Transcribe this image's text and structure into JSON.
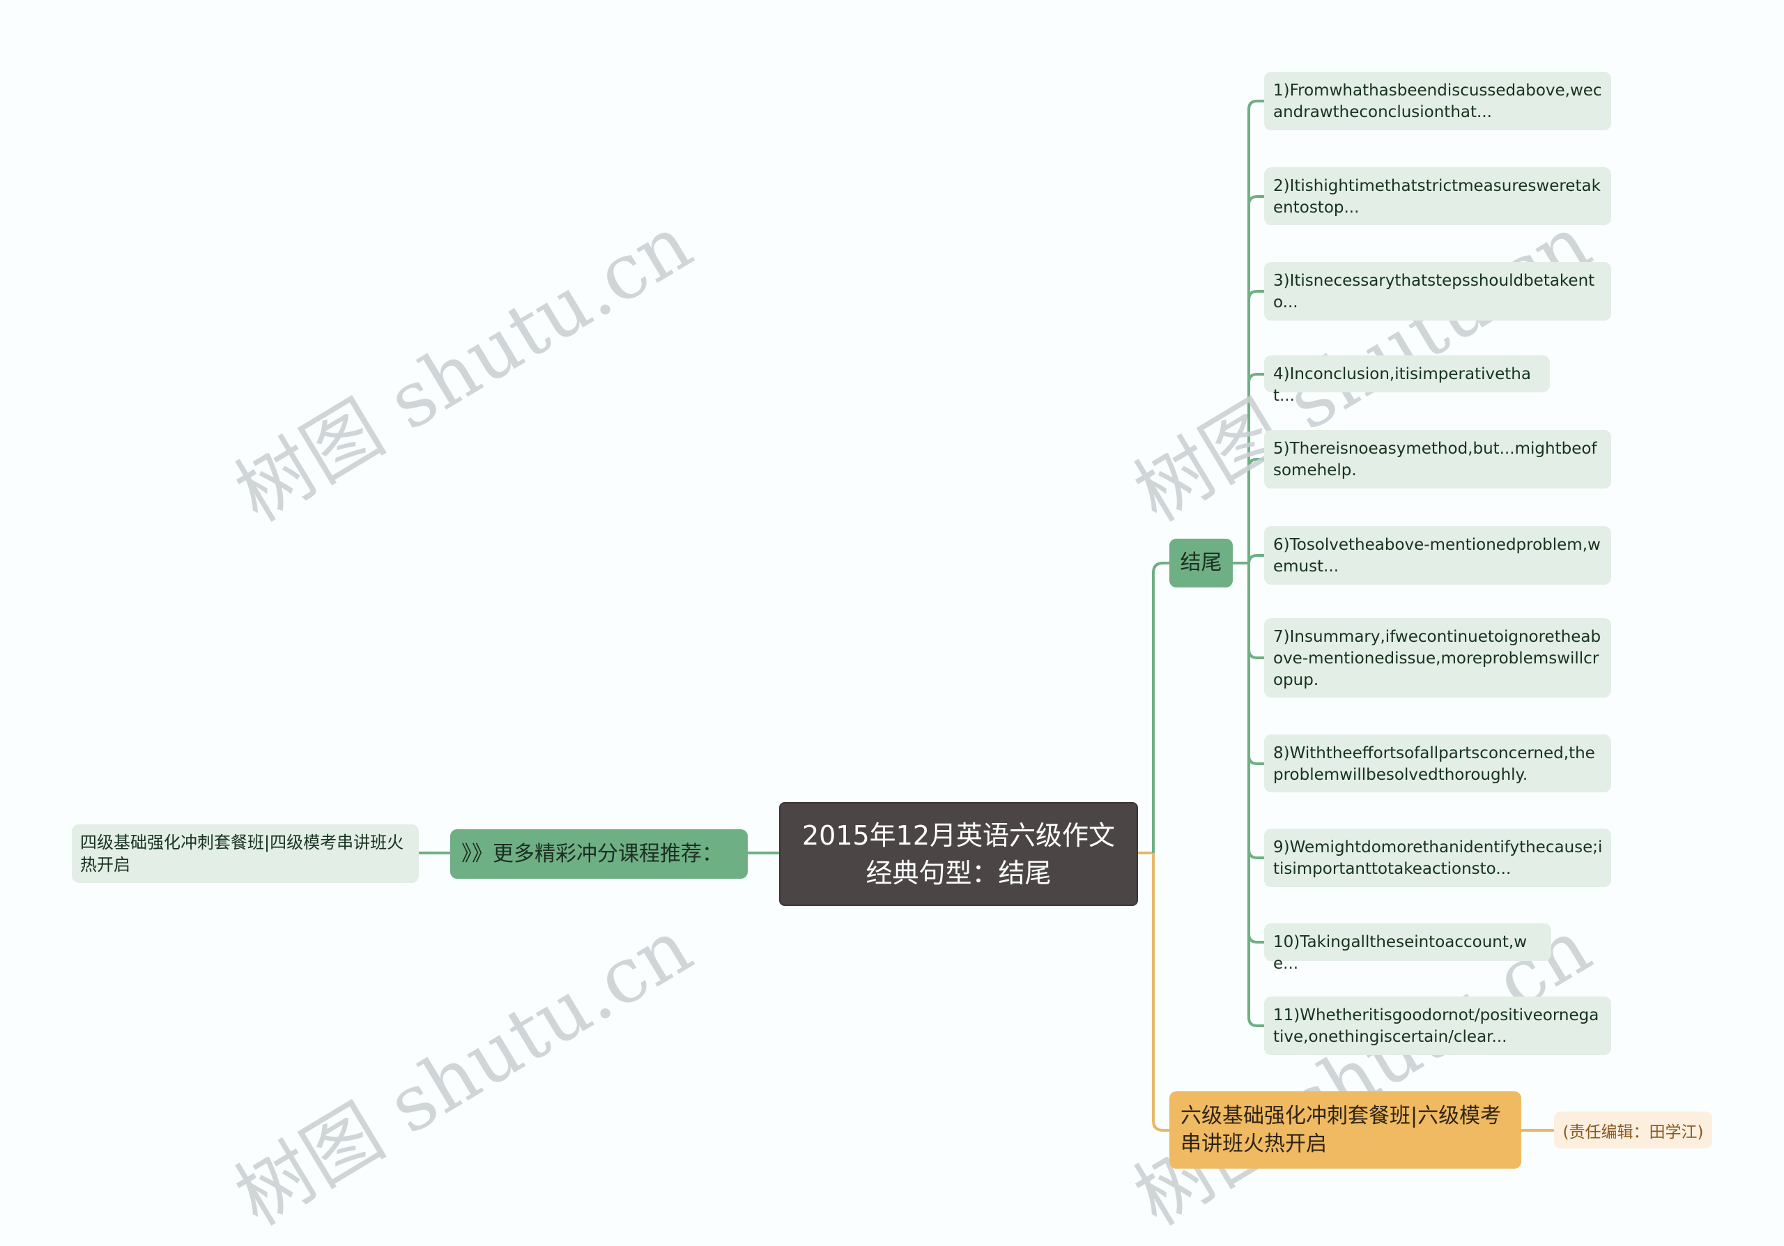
{
  "central_topic": "2015年12月英语六级作文经典句型：结尾",
  "branches": {
    "left": {
      "label": "》》更多精彩冲分课程推荐：",
      "child": "四级基础强化冲刺套餐班|四级模考串讲班火热开启",
      "color": "#6faf84"
    },
    "ending": {
      "label": "结尾",
      "color": "#6faf84",
      "sentences": [
        "1)Fromwhathasbeendiscussedabove,wecandrawtheconclusionthat...",
        "2)Itishightimethatstrictmeasuresweretakentostop...",
        "3)Itisnecessarythatstepsshouldbetakento...",
        "4)Inconclusion,itisimperativethat...",
        "5)Thereisnoeasymethod,but...mightbeofsomehelp.",
        "6)Tosolvetheabove-mentionedproblem,wemust...",
        "7)Insummary,ifwecontinuetoignoretheabove-mentionedissue,moreproblemswillcropup.",
        "8)Withtheeffortsofallpartsconcerned,theproblemwillbesolvedthoroughly.",
        "9)Wemightdomorethanidentifythecause;itisimportanttotakeactionsto...",
        "10)Takingalltheseintoaccount,we...",
        "11)Whetheritisgoodornot/positiveornegative,onethingiscertain/clear..."
      ]
    },
    "promo": {
      "label": "六级基础强化冲刺套餐班|六级模考串讲班火热开启",
      "note": "(责任编辑：田学江)",
      "color": "#f0ba62"
    }
  },
  "watermark": "树图 shutu.cn",
  "colors": {
    "background": "#fbfefe",
    "central": "#4b4645",
    "leaf": "#e3eee6",
    "green_line": "#6faf84",
    "orange_line": "#e8b867",
    "note_bg": "#fcefe0"
  }
}
